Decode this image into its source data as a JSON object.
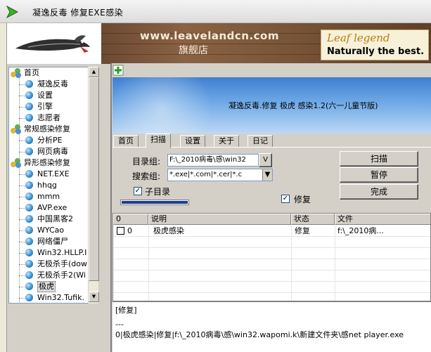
{
  "window": {
    "title": "凝逸反毒 修复EXE感染"
  },
  "banner": {
    "url": "www.leavelandcn.com",
    "shop": "旗舰店",
    "brand": "Leaf legend",
    "tagline": "Naturally the best."
  },
  "tree": {
    "items": [
      {
        "label": "首页",
        "type": "group"
      },
      {
        "label": "凝逸反毒",
        "type": "leaf"
      },
      {
        "label": "设置",
        "type": "leaf"
      },
      {
        "label": "引擎",
        "type": "leaf"
      },
      {
        "label": "志愿者",
        "type": "leaf"
      },
      {
        "label": "常规感染修复",
        "type": "group"
      },
      {
        "label": "分析PE",
        "type": "leaf"
      },
      {
        "label": "网页病毒",
        "type": "leaf"
      },
      {
        "label": "异形感染修复",
        "type": "group"
      },
      {
        "label": "NET.EXE",
        "type": "leaf"
      },
      {
        "label": "hhqg",
        "type": "leaf"
      },
      {
        "label": "mmm",
        "type": "leaf"
      },
      {
        "label": "AVP.exe",
        "type": "leaf"
      },
      {
        "label": "中国黑客2",
        "type": "leaf"
      },
      {
        "label": "WYCao",
        "type": "leaf"
      },
      {
        "label": "网络僵尸",
        "type": "leaf"
      },
      {
        "label": "Win32.HLLP.I",
        "type": "leaf"
      },
      {
        "label": "无极杀手(dow",
        "type": "leaf"
      },
      {
        "label": "无极杀手2(Wi",
        "type": "leaf"
      },
      {
        "label": "极虎",
        "type": "leaf",
        "selected": true
      },
      {
        "label": "Win32.Tufik.",
        "type": "leaf"
      }
    ]
  },
  "header": {
    "title": "凝逸反毒.修复 极虎 感染1.2(六一儿童节版)"
  },
  "tabs": [
    {
      "label": "首页"
    },
    {
      "label": "扫描",
      "active": true
    },
    {
      "label": "设置"
    },
    {
      "label": "关于"
    },
    {
      "label": "日记"
    }
  ],
  "scan": {
    "dir_label": "目录组:",
    "dir_value": "F:\\_2010病毒\\感\\win32",
    "dir_button": "V",
    "search_label": "搜索组:",
    "search_value": "*.exe|*.com|*.cer|*.c",
    "subdir_label": "子目录",
    "subdir_checked": true,
    "repair_label": "修复",
    "repair_checked": true,
    "progress": 1.0
  },
  "buttons": {
    "scan": "扫描",
    "pause": "暂停",
    "finish": "完成"
  },
  "table": {
    "columns": [
      "0",
      "说明",
      "状态",
      "文件"
    ],
    "rows": [
      {
        "index": "0",
        "desc": "极虎感染",
        "status": "修复",
        "file": "f:\\_2010病..."
      }
    ]
  },
  "log": {
    "lines": [
      "[修复]",
      "---",
      "0|极虎感染|修复|f:\\_2010病毒\\感\\win32.wapomi.k\\新建文件夹\\感net player.exe"
    ]
  }
}
